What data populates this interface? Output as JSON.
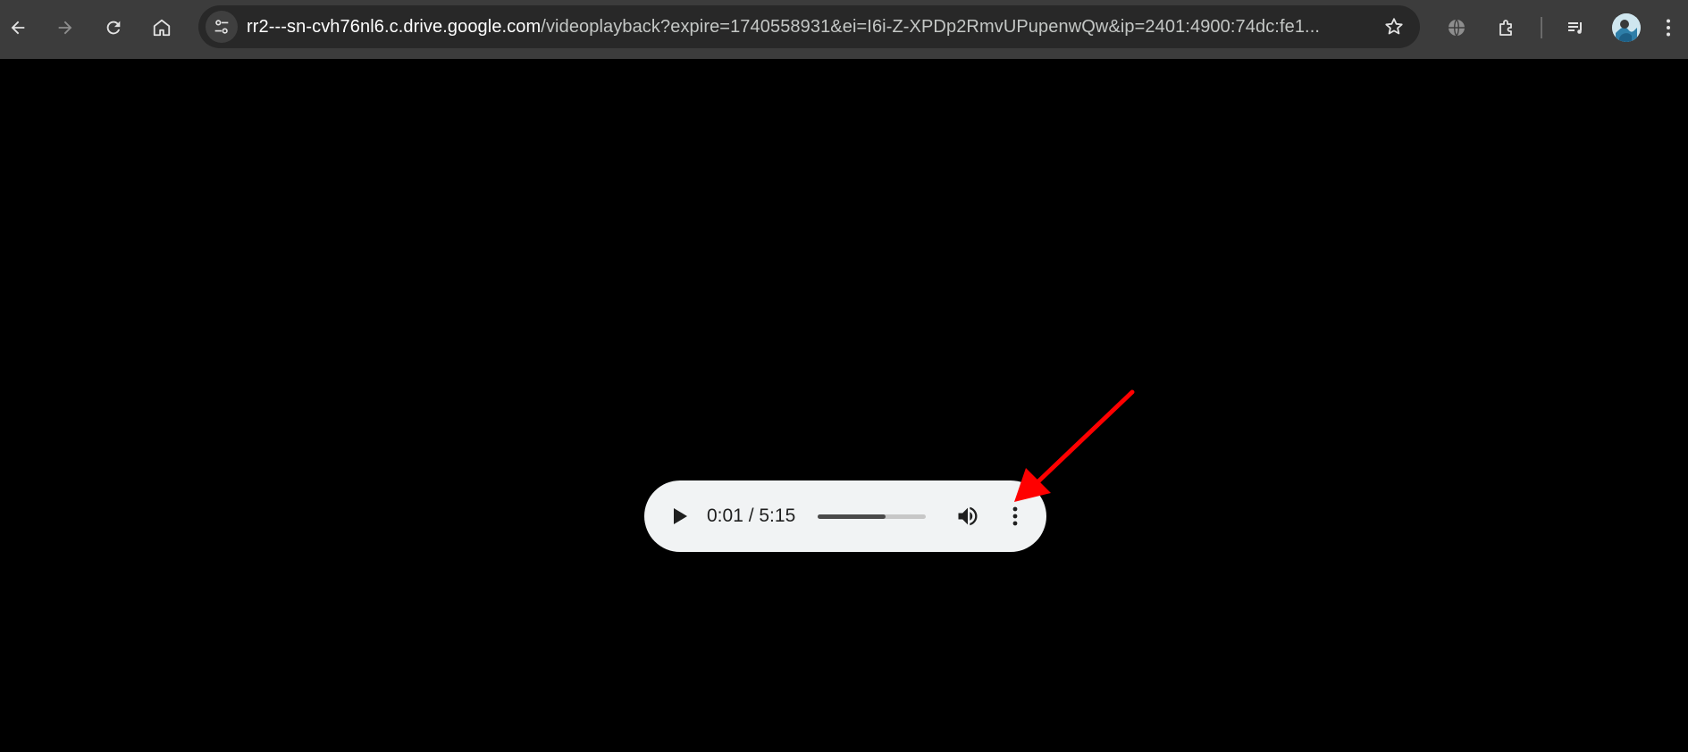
{
  "browser": {
    "url": {
      "host": "rr2---sn-cvh76nl6.c.drive.google.com",
      "rest": "/videoplayback?expire=1740558931&ei=I6i-Z-XPDp2RmvUPupenwQw&ip=2401:4900:74dc:fe1..."
    },
    "icons": {
      "back": "arrow-left-icon",
      "forward": "arrow-right-icon",
      "reload": "reload-icon",
      "home": "home-icon",
      "site_info": "tune-icon",
      "bookmark": "star-icon",
      "translate": "globe-icon",
      "extensions": "puzzle-icon",
      "media": "media-queue-icon",
      "menu": "kebab-menu-icon"
    },
    "colors": {
      "toolbar": "#3c3c3c",
      "omnibox": "#282828",
      "icon": "#e3e3e3",
      "disabled_icon": "#8e8e8e"
    }
  },
  "player": {
    "time_display": "0:01 / 5:15",
    "seek_buffered_fraction": 0.63,
    "icons": {
      "play": "play-icon",
      "volume": "volume-icon",
      "more": "more-options-icon"
    },
    "colors": {
      "background": "#f1f3f4",
      "track": "#c7c7c7",
      "fill": "#4a4a4a"
    }
  },
  "annotation": {
    "arrow_color": "#ff0000"
  }
}
